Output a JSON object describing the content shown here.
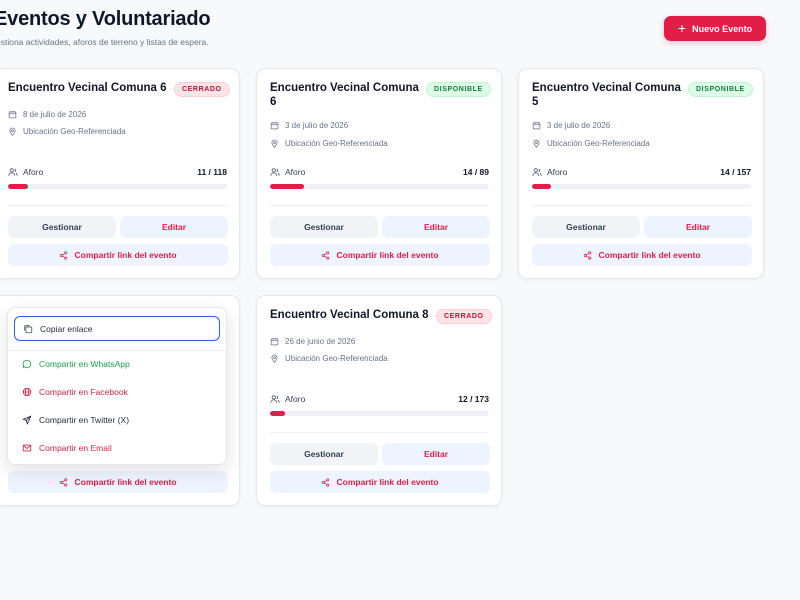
{
  "header": {
    "title": "Eventos y Voluntariado",
    "subtitle": "estiona actividades, aforos de terreno y listas de espera.",
    "new_button": "Nuevo Evento"
  },
  "cards": [
    {
      "title": "Encuentro Vecinal Comuna 6",
      "status": "CERRADO",
      "date": "8 de julio de 2026",
      "location": "Ubicación Geo-Referenciada",
      "aforo_label": "Aforo",
      "aforo_value": "11 / 118",
      "aforo_fill": 0.093,
      "gestionar": "Gestionar",
      "editar": "Editar",
      "share": "Compartir link del evento"
    },
    {
      "title": "Encuentro Vecinal Comuna 6",
      "status": "DISPONIBLE",
      "date": "3 de julio de 2026",
      "location": "Ubicación Geo-Referenciada",
      "aforo_label": "Aforo",
      "aforo_value": "14 / 89",
      "aforo_fill": 0.157,
      "gestionar": "Gestionar",
      "editar": "Editar",
      "share": "Compartir link del evento"
    },
    {
      "title": "Encuentro Vecinal Comuna 5",
      "status": "DISPONIBLE",
      "date": "3 de julio de 2026",
      "location": "Ubicación Geo-Referenciada",
      "aforo_label": "Aforo",
      "aforo_value": "14 / 157",
      "aforo_fill": 0.089,
      "gestionar": "Gestionar",
      "editar": "Editar",
      "share": "Compartir link del evento"
    },
    {
      "share": "Compartir link del evento"
    },
    {
      "title": "Encuentro Vecinal Comuna 8",
      "status": "CERRADO",
      "date": "26 de junio de 2026",
      "location": "Ubicación Geo-Referenciada",
      "aforo_label": "Aforo",
      "aforo_value": "12 / 173",
      "aforo_fill": 0.069,
      "gestionar": "Gestionar",
      "editar": "Editar",
      "share": "Compartir link del evento"
    }
  ],
  "share_menu": {
    "copy": "Copiar enlace",
    "whatsapp": "Compartir en WhatsApp",
    "facebook": "Compartir en Facebook",
    "twitter": "Compartir en Twitter (X)",
    "email": "Compartir en Email"
  },
  "colors": {
    "accent": "#e11d48",
    "whatsapp": "#16a34a",
    "facebook": "#e11d48",
    "email": "#e11d48",
    "focus_ring": "#2563eb"
  }
}
